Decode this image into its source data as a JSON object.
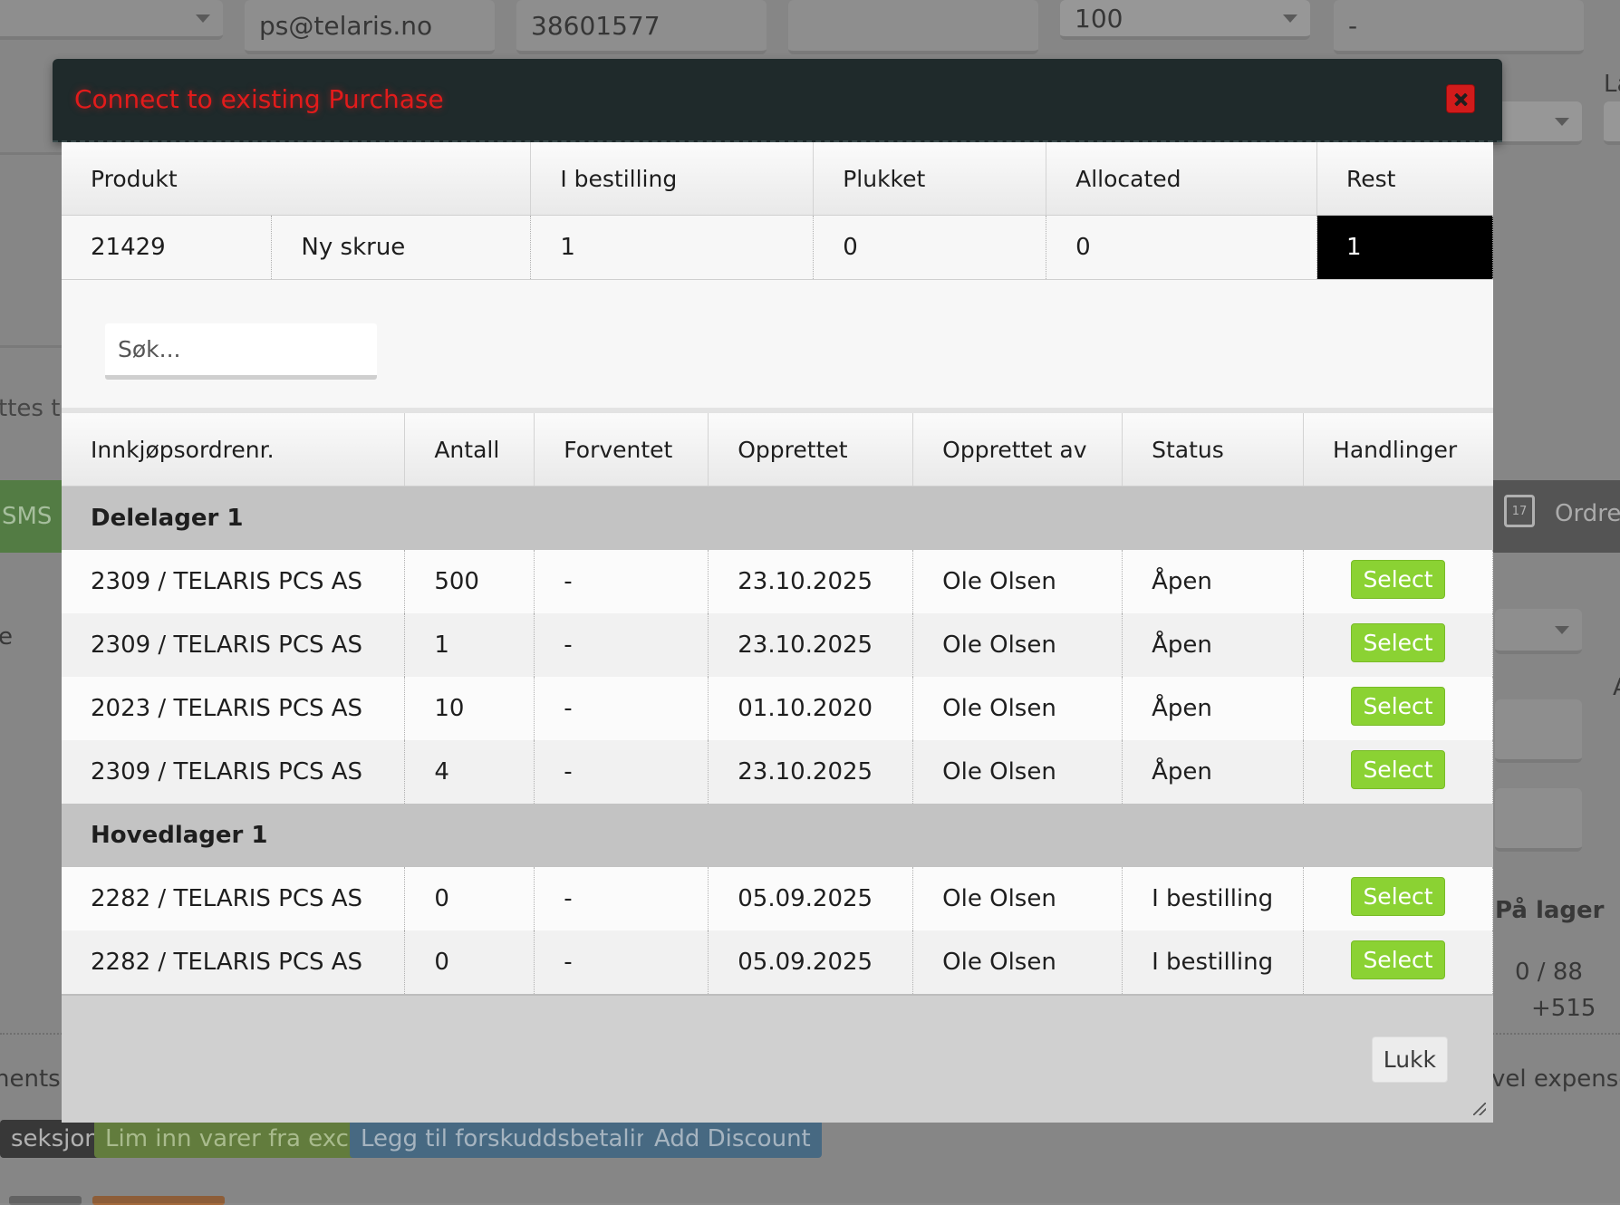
{
  "background": {
    "email": "ps@telaris.no",
    "phone": "38601577",
    "quantity_select": "100",
    "dash": "-",
    "label_la": "La",
    "text_ttes": "ttes til",
    "sms_label": "SMS",
    "ordre_label": "Ordrep",
    "text_e": "e",
    "text_a": "A",
    "pa_lager": "På lager",
    "stock_ratio": "0 / 88",
    "stock_plus": "+515",
    "ments": "nents",
    "travel_expenses": "vel expenses",
    "seksjon": "seksjon",
    "lim_inn": "Lim inn varer fra excel",
    "legg_til": "Legg til forskuddsbetaling",
    "add_discount": "Add Discount",
    "calendar_day": "17"
  },
  "modal": {
    "title": "Connect to existing Purchase",
    "product_table": {
      "headers": [
        "Produkt",
        "I bestilling",
        "Plukket",
        "Allocated",
        "Rest"
      ],
      "row": {
        "id": "21429",
        "name": "Ny skrue",
        "i_bestilling": "1",
        "plukket": "0",
        "allocated": "0",
        "rest": "1"
      }
    },
    "search": {
      "placeholder": "Søk..."
    },
    "po_table": {
      "headers": [
        "Innkjøpsordrenr.",
        "Antall",
        "Forventet",
        "Opprettet",
        "Opprettet av",
        "Status",
        "Handlinger"
      ],
      "groups": [
        {
          "name": "Delelager 1",
          "rows": [
            {
              "order": "2309 / TELARIS PCS AS",
              "antall": "500",
              "forventet": "-",
              "opprettet": "23.10.2025",
              "av": "Ole Olsen",
              "status": "Åpen",
              "action": "Select"
            },
            {
              "order": "2309 / TELARIS PCS AS",
              "antall": "1",
              "forventet": "-",
              "opprettet": "23.10.2025",
              "av": "Ole Olsen",
              "status": "Åpen",
              "action": "Select"
            },
            {
              "order": "2023 / TELARIS PCS AS",
              "antall": "10",
              "forventet": "-",
              "opprettet": "01.10.2020",
              "av": "Ole Olsen",
              "status": "Åpen",
              "action": "Select"
            },
            {
              "order": "2309 / TELARIS PCS AS",
              "antall": "4",
              "forventet": "-",
              "opprettet": "23.10.2025",
              "av": "Ole Olsen",
              "status": "Åpen",
              "action": "Select"
            }
          ]
        },
        {
          "name": "Hovedlager 1",
          "rows": [
            {
              "order": "2282 / TELARIS PCS AS",
              "antall": "0",
              "forventet": "-",
              "opprettet": "05.09.2025",
              "av": "Ole Olsen",
              "status": "I bestilling",
              "action": "Select"
            },
            {
              "order": "2282 / TELARIS PCS AS",
              "antall": "0",
              "forventet": "-",
              "opprettet": "05.09.2025",
              "av": "Ole Olsen",
              "status": "I bestilling",
              "action": "Select"
            }
          ]
        }
      ]
    },
    "close_label": "Lukk"
  },
  "colors": {
    "title_red": "#e21b1b",
    "select_green": "#8bd233",
    "header_dark": "#1f2a2b"
  }
}
